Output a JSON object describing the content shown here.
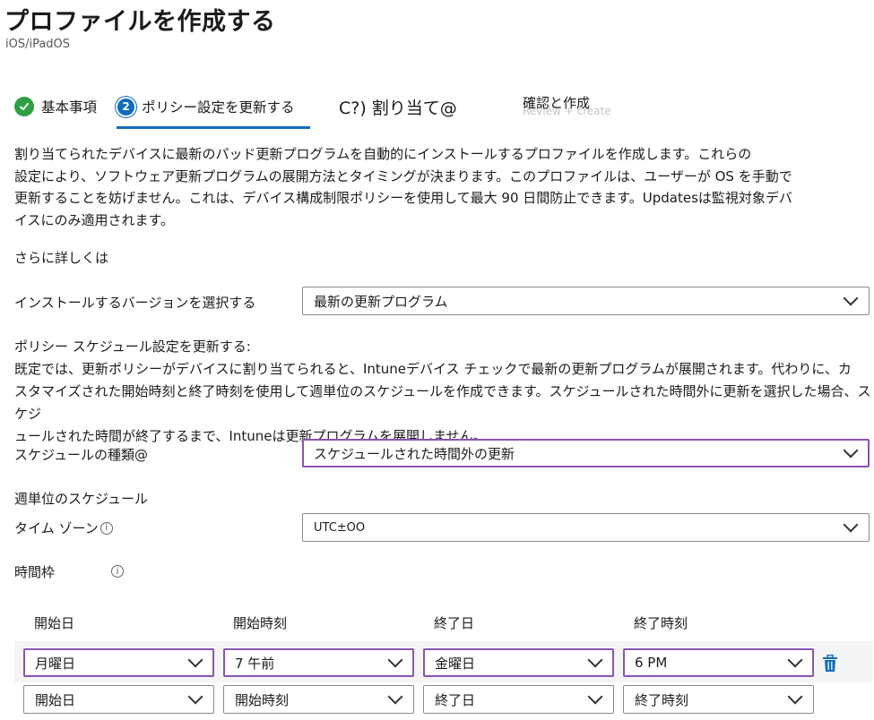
{
  "header": {
    "title": "プロファイルを作成する",
    "subtitle": "iOS/iPadOS"
  },
  "wizard": {
    "steps": [
      {
        "label": "基本事項",
        "number": "",
        "state": "done"
      },
      {
        "label": "ポリシー設定を更新する",
        "number": "2",
        "state": "active"
      },
      {
        "label": "C?) 割り当て@",
        "number": "",
        "state": "pending"
      },
      {
        "label": "確認と作成",
        "number": "",
        "state": "pending"
      }
    ],
    "ghost_text": "Review + create"
  },
  "description": {
    "lines": [
      "割り当てられたデバイスに最新のパッド更新プログラムを自動的にインストールするプロファイルを作成します。これらの",
      "設定により、ソフトウェア更新プログラムの展開方法とタイミングが決まります。このプロファイルは、ユーザーが OS を手動で",
      "更新することを妨げません。これは、デバイス構成制限ポリシーを使用して最大 90 日間防止できます。Updatesは監視対象デバ",
      "イスにのみ適用されます。"
    ],
    "learn_more": "さらに詳しくは"
  },
  "version": {
    "label": "インストールするバージョンを選択する",
    "value": "最新の更新プログラム"
  },
  "schedule_section": {
    "heading": "ポリシー スケジュール設定を更新する:",
    "lines": [
      "既定では、更新ポリシーがデバイスに割り当てられると、Intuneデバイス チェックで最新の更新プログラムが展開されます。代わりに、カ",
      "スタマイズされた開始時刻と終了時刻を使用して週単位のスケジュールを作成できます。スケジュールされた時間外に更新を選択した場合、スケジ",
      "ュールされた時間が終了するまで、Intuneは更新プログラムを展開しません。"
    ]
  },
  "schedule_type": {
    "label": "スケジュールの種類@",
    "value": "スケジュールされた時間外の更新"
  },
  "weekly": {
    "heading": "週単位のスケジュール",
    "timezone_label": "タイム ゾーン",
    "timezone_value": "UTC±OO",
    "timeslot_label": "時間枠"
  },
  "table": {
    "headers": [
      "開始日",
      "開始時刻",
      "終了日",
      "終了時刻"
    ],
    "rows": [
      [
        "月曜日",
        "7 午前",
        "金曜日",
        "6 PM"
      ],
      [
        "開始日",
        "開始時刻",
        "終了日",
        "終了時刻"
      ]
    ]
  },
  "colors": {
    "accent": "#0f6cbd",
    "success": "#2ea043",
    "focus_border": "#8b53b4"
  },
  "icons": {
    "step_done": "checkmark-icon",
    "info": "info-icon",
    "dropdown": "chevron-down-icon",
    "delete": "trash-icon"
  }
}
